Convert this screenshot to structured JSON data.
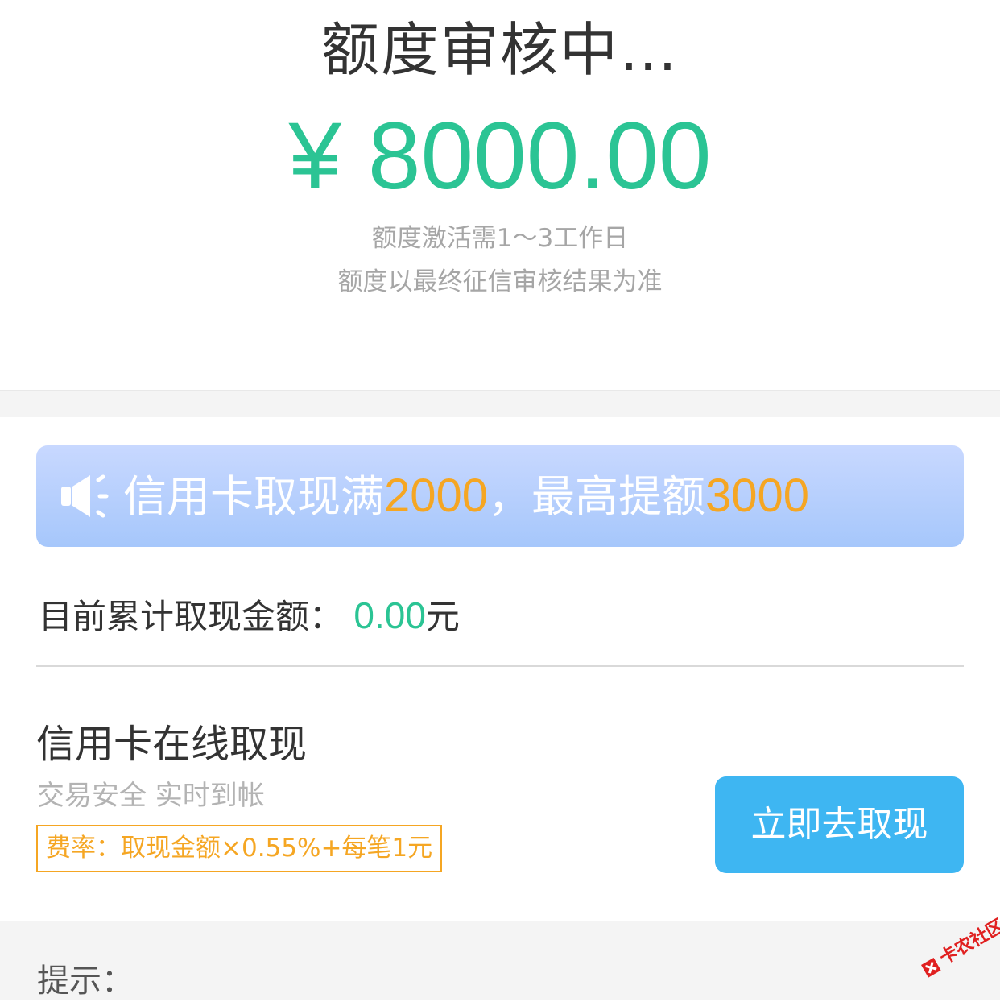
{
  "header": {
    "title": "额度审核中…",
    "amount": "¥ 8000.00",
    "note_line1": "额度激活需1～3工作日",
    "note_line2": "额度以最终征信审核结果为准"
  },
  "banner": {
    "icon": "speaker-icon",
    "text_part1": "信用卡取现满",
    "highlight1": "2000",
    "text_part2": "，最高提额",
    "highlight2": "3000"
  },
  "cumulative": {
    "label": "目前累计取现金额：",
    "value": "0.00",
    "unit": "元"
  },
  "online_cash": {
    "title": "信用卡在线取现",
    "subtitle": "交易安全 实时到帐",
    "rate": "费率：取现金额×0.55%+每笔1元",
    "button_label": "立即去取现"
  },
  "tips": {
    "label": "提示："
  },
  "watermark": {
    "text": "卡农社区"
  },
  "colors": {
    "accent_green": "#2bc494",
    "highlight_orange": "#f5a623",
    "button_blue": "#3eb6f2"
  }
}
